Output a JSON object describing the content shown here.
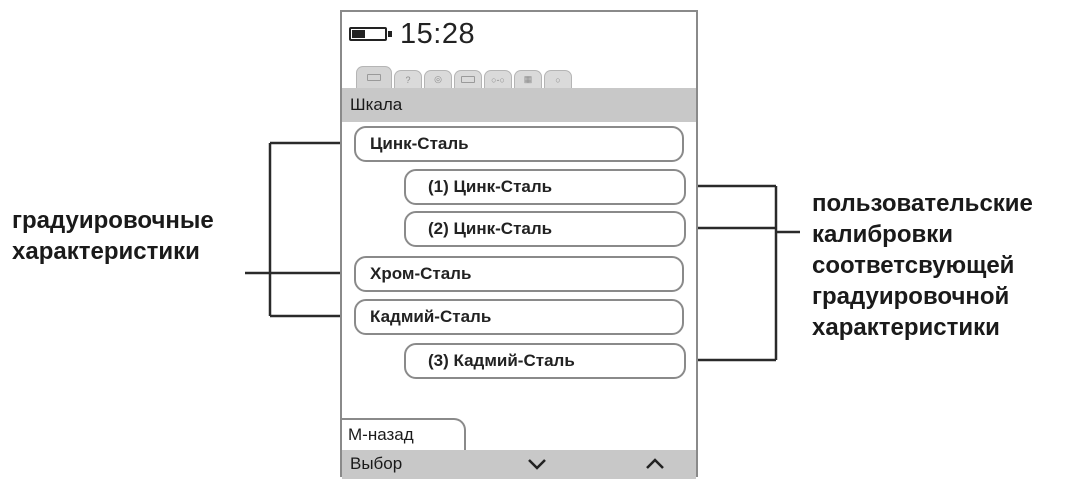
{
  "status": {
    "time": "15:28",
    "battery_level": 0.4
  },
  "tabs": [
    {
      "id": "scale",
      "active": true
    },
    {
      "id": "t2",
      "active": false
    },
    {
      "id": "t3",
      "active": false
    },
    {
      "id": "t4",
      "active": false
    },
    {
      "id": "t5",
      "active": false
    },
    {
      "id": "t6",
      "active": false
    },
    {
      "id": "t7",
      "active": false
    }
  ],
  "header": {
    "title": "Шкала"
  },
  "list": [
    {
      "label": "Цинк-Сталь",
      "kind": "calibration"
    },
    {
      "label": "(1) Цинк-Сталь",
      "kind": "user"
    },
    {
      "label": "(2) Цинк-Сталь",
      "kind": "user"
    },
    {
      "label": "Хром-Сталь",
      "kind": "calibration"
    },
    {
      "label": "Кадмий-Сталь",
      "kind": "calibration"
    },
    {
      "label": "(3) Кадмий-Сталь",
      "kind": "user"
    }
  ],
  "softkey": {
    "back_label": "М-назад"
  },
  "bottom_bar": {
    "select_label": "Выбор",
    "down_icon": "chevron-down-icon",
    "up_icon": "chevron-up-icon"
  },
  "annotations": {
    "left": {
      "line1": "градуировочные",
      "line2": "характеристики"
    },
    "right": {
      "line1": "пользовательские",
      "line2": "калибровки",
      "line3": "соответсвующей",
      "line4": "градуировочной",
      "line5": "характеристики"
    }
  }
}
